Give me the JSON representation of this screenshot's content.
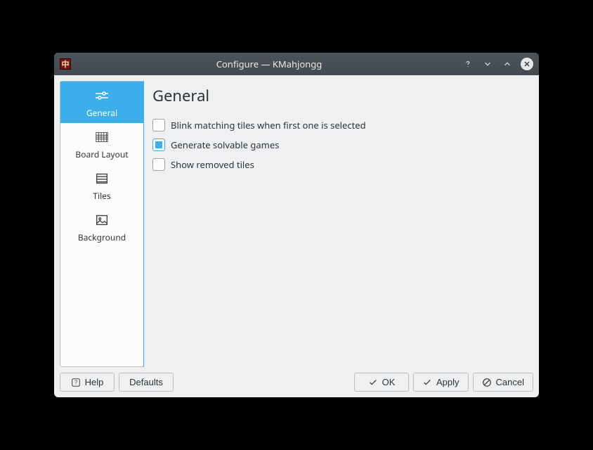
{
  "window": {
    "title": "Configure — KMahjongg"
  },
  "sidebar": {
    "items": [
      {
        "label": "General"
      },
      {
        "label": "Board Layout"
      },
      {
        "label": "Tiles"
      },
      {
        "label": "Background"
      }
    ]
  },
  "page": {
    "heading": "General",
    "options": [
      {
        "label": "Blink matching tiles when first one is selected",
        "checked": false
      },
      {
        "label": "Generate solvable games",
        "checked": true
      },
      {
        "label": "Show removed tiles",
        "checked": false
      }
    ]
  },
  "buttons": {
    "help": "Help",
    "defaults": "Defaults",
    "ok": "OK",
    "apply": "Apply",
    "cancel": "Cancel"
  }
}
